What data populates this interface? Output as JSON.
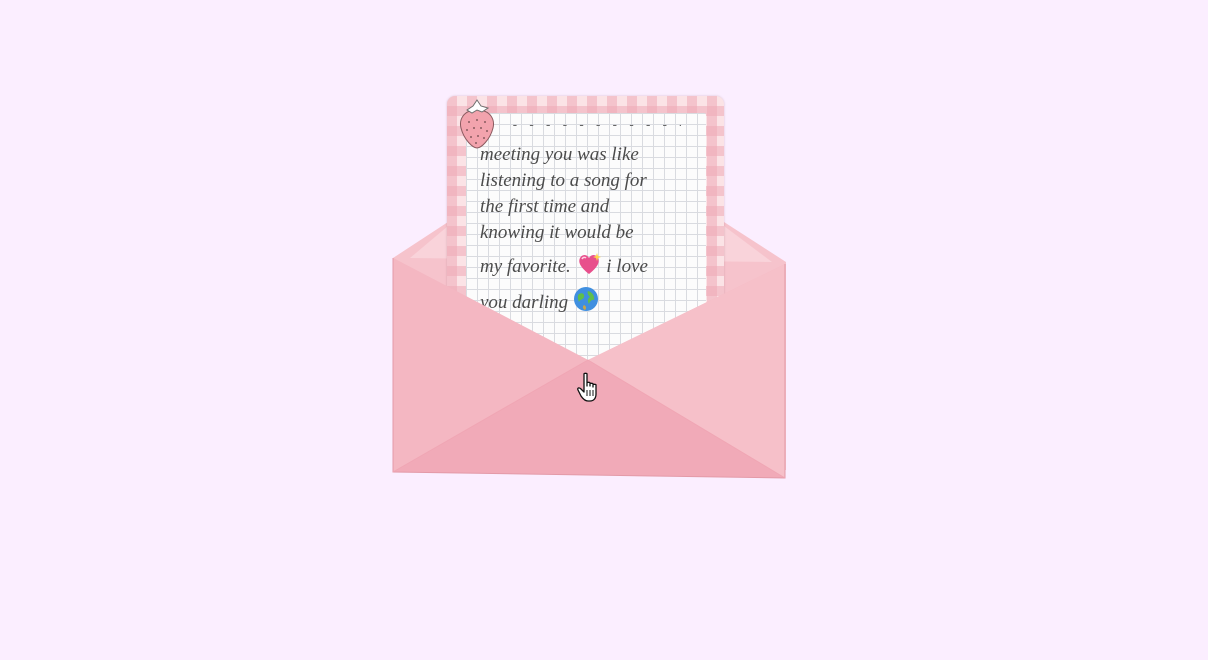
{
  "letter": {
    "dashes": "- - - - - - - - - - - - - -",
    "lines": [
      "meeting you was like",
      "listening to a song for",
      "the first time and",
      "knowing it would be",
      "my favorite.",
      "i love",
      "you darling"
    ]
  },
  "icons": {
    "strawberry": "strawberry-icon",
    "heart": "sparkling-heart-icon",
    "globe": "globe-icon",
    "cursor": "hand-pointer-icon"
  },
  "colors": {
    "background": "#fbeeff",
    "envelope_front": "#f4b6c1",
    "envelope_bottom": "#f1a8b6",
    "gingham": "#efaab6"
  }
}
